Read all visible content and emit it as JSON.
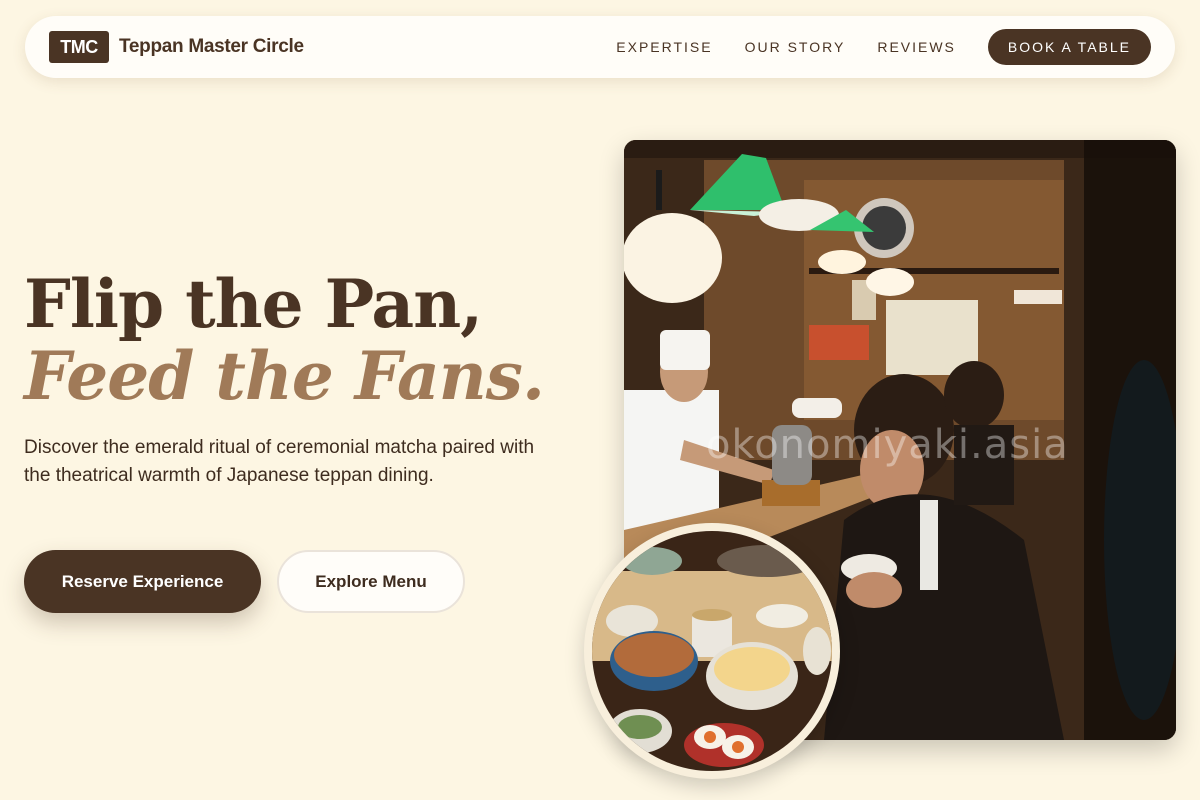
{
  "nav": {
    "logo": "TMC",
    "brand": "Teppan Master Circle",
    "links": [
      "EXPERTISE",
      "OUR STORY",
      "REVIEWS"
    ],
    "cta": "BOOK A TABLE"
  },
  "hero": {
    "title_line1": "Flip the Pan,",
    "title_line2": "Feed the Fans.",
    "description": "Discover the emerald ritual of ceremonial matcha paired with the theatrical warmth of Japanese teppan dining.",
    "primary_button": "Reserve Experience",
    "secondary_button": "Explore Menu"
  },
  "images": {
    "main_watermark": "okonomiyaki.asia"
  },
  "colors": {
    "background": "#fdf6e3",
    "brand_dark": "#4a3424",
    "accent_tan": "#a07a58"
  }
}
